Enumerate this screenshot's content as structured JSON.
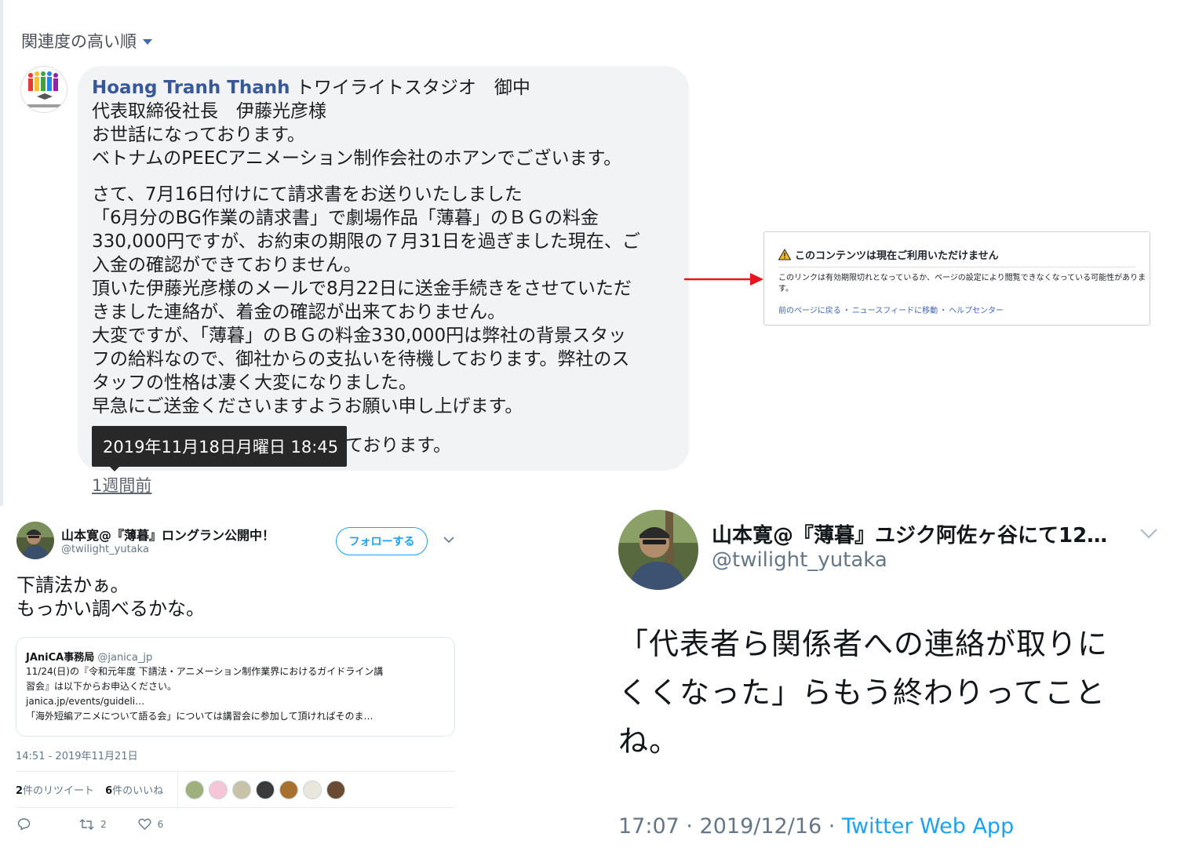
{
  "facebook": {
    "sort_label": "関連度の高い順",
    "comment": {
      "author": "Hoang Tranh Thanh",
      "first_line_rest": " トワイライトスタジオ　御中",
      "lines_a": [
        "代表取締役社長　伊藤光彦様",
        "お世話になっております。",
        "ベトナムのPEECアニメーション制作会社のホアンでございます。"
      ],
      "lines_b": [
        "さて、7月16日付けにて請求書をお送りいたしました",
        "「6月分のBG作業の請求書」で劇場作品「薄暮」のＢＧの料金",
        "330,000円ですが、お約束の期限の７月31日を過ぎました現在、ご",
        "入金の確認ができておりません。",
        "頂いた伊藤光彦様のメールで8月22日に送金手続きをさせていただ",
        "きました連絡が、着金の確認が出来ておりません。",
        "大変ですが、「薄暮」のＢＧの料金330,000円は弊社の背景スタッ",
        "フの給料なので、御社からの支払いを待機しております。弊社のス",
        "タッフの性格は凄く大変になりました。",
        "早急にご送金くださいますようお願い申し上げます。"
      ],
      "last_line_visible": "ております。",
      "tooltip": "2019年11月18日月曜日 18:45",
      "timestamp": "1週間前"
    },
    "unavailable": {
      "title": "このコンテンツは現在ご利用いただけません",
      "body": "このリンクは有効期限切れとなっているか、ページの設定により閲覧できなくなっている可能性があります。",
      "links": [
        "前のページに戻る",
        "ニュースフィードに移動",
        "ヘルプセンター"
      ],
      "link_sep": "・"
    },
    "colors": {
      "link": "#385898",
      "bubble": "#f2f3f5",
      "arrow": "#e8141b"
    }
  },
  "tweet1": {
    "name": "山本寛@『薄暮』ロングラン公開中！",
    "handle": "@twilight_yutaka",
    "follow_label": "フォローする",
    "text_lines": [
      "下請法かぁ。",
      "もっかい調べるかな。"
    ],
    "quote": {
      "name": "JAniCA事務局",
      "handle": "@janica_jp",
      "lines": [
        "11/24(日)の『令和元年度 下請法・アニメーション制作業界におけるガイドライン講",
        "習会』は以下からお申込ください。",
        "janica.jp/events/guideli…",
        "「海外短編アニメについて語る会」については講習会に参加して頂ければそのま…"
      ]
    },
    "date": "14:51 - 2019年11月21日",
    "retweet_count": "2",
    "retweet_label": "件のリツイート",
    "like_count": "6",
    "like_label": "件のいいね",
    "actions": {
      "retweets": "2",
      "likes": "6"
    },
    "colors": {
      "accent": "#1da1f2"
    }
  },
  "tweet2": {
    "name": "山本寛@『薄暮』ユジク阿佐ヶ谷にて12…",
    "handle": "@twilight_yutaka",
    "text_lines": [
      "「代表者ら関係者への連絡が取りに",
      "くくなった」らもう終わりってこと",
      "ね。"
    ],
    "time": "17:07 · 2019/12/16 · ",
    "app": "Twitter Web App"
  }
}
